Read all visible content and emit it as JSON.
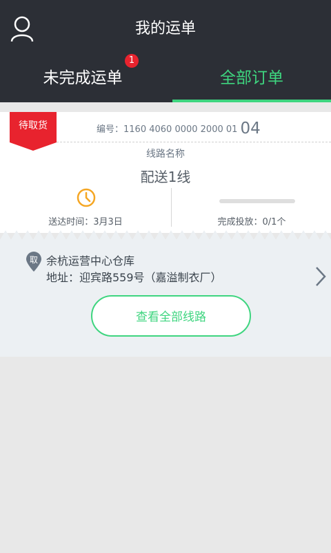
{
  "header": {
    "title": "我的运单",
    "tabs": [
      {
        "label": "未完成运单",
        "badge": "1"
      },
      {
        "label": "全部订单"
      }
    ]
  },
  "order": {
    "status_tag": "待取货",
    "code_label": "编号：",
    "code_value": "1160 4060 0000 2000 01",
    "code_tail": "04",
    "route_label": "线路名称",
    "route_name": "配送1线",
    "delivery_time": "送达时间：3月3日",
    "completion": "完成投放：0/1个",
    "completion_fraction": 0.0
  },
  "pickup": {
    "pin_label": "取",
    "warehouse": "余杭运营中心仓库",
    "address": "地址：迎宾路559号（嘉溢制衣厂）"
  },
  "view_all_button": "查看全部线路",
  "colors": {
    "header_bg": "#2c2f36",
    "accent_green": "#3ed57f",
    "tag_red": "#e8232e",
    "clock_orange": "#f5a623"
  }
}
